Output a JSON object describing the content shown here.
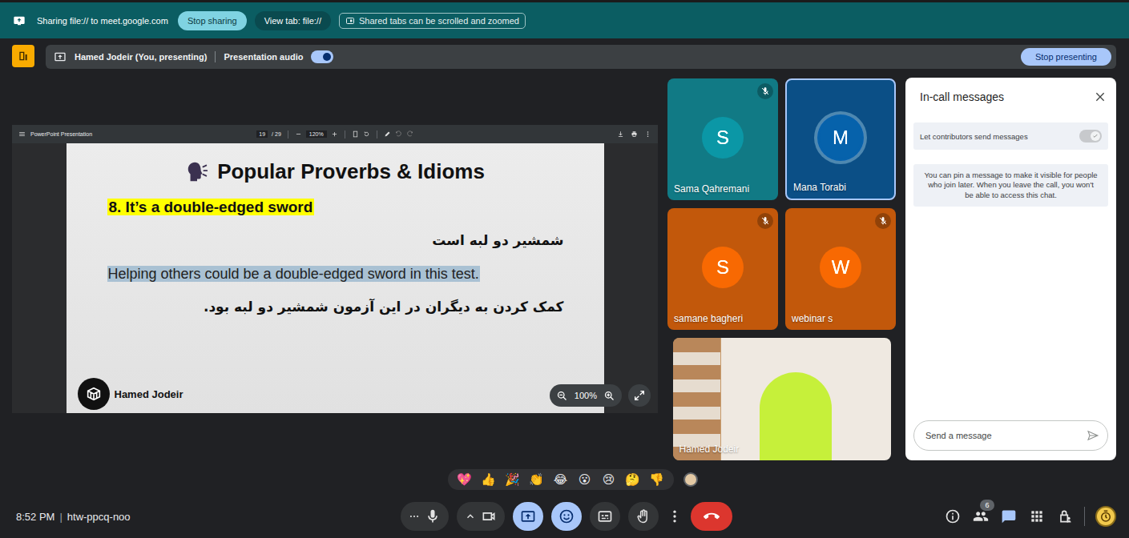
{
  "share_bar": {
    "status": "Sharing file:// to meet.google.com",
    "stop": "Stop sharing",
    "view_tab": "View tab: file://",
    "hint": "Shared tabs can be scrolled and zoomed"
  },
  "presenter_bar": {
    "presenter": "Hamed Jodeir (You, presenting)",
    "audio_label": "Presentation audio",
    "audio_on": true,
    "stop": "Stop presenting"
  },
  "viewer": {
    "title": "PowerPoint Presentation",
    "page": "19",
    "pages": "/ 29",
    "zoom": "120%",
    "fit_zoom": "100%"
  },
  "slide": {
    "title": "Popular Proverbs & Idioms",
    "idiom": "8. It’s a double-edged sword",
    "idiom_fa": "شمشیر دو لبه است",
    "example": "Helping others could be a double-edged sword in this test.",
    "example_fa": "کمک کردن به دیگران در این آزمون شمشیر دو لبه بود.",
    "author": "Hamed Jodeir"
  },
  "participants": [
    {
      "name": "Sama Qahremani",
      "initial": "S",
      "muted": true,
      "speaking": false,
      "color": "#117a85"
    },
    {
      "name": "Mana Torabi",
      "initial": "M",
      "muted": false,
      "speaking": true,
      "color": "#0b4f86"
    },
    {
      "name": "samane bagheri",
      "initial": "S",
      "muted": true,
      "speaking": false,
      "color": "#c2580b"
    },
    {
      "name": "webinar s",
      "initial": "W",
      "muted": true,
      "speaking": false,
      "color": "#c2580b"
    }
  ],
  "self_view": {
    "name": "Hamed Jodeir"
  },
  "chat": {
    "title": "In-call messages",
    "setting": {
      "label": "Let contributors send messages",
      "on": true
    },
    "info": "You can pin a message to make it visible for people who join later. When you leave the call, you won't be able to access this chat.",
    "placeholder": "Send a message"
  },
  "reactions": [
    "💖",
    "👍",
    "🎉",
    "👏",
    "😂",
    "😮",
    "😢",
    "🤔",
    "👎"
  ],
  "meeting": {
    "time": "8:52 PM",
    "separator": "|",
    "code": "htw-ppcq-noo"
  },
  "controls": [
    {
      "kind": "mic",
      "active": false
    },
    {
      "kind": "camera",
      "active": false
    },
    {
      "kind": "present",
      "active": true
    },
    {
      "kind": "reactions",
      "active": true
    },
    {
      "kind": "captions",
      "active": false
    },
    {
      "kind": "hand",
      "active": false
    },
    {
      "kind": "more",
      "active": false
    },
    {
      "kind": "leave",
      "active": false
    }
  ],
  "side_controls": [
    {
      "kind": "info",
      "active": false
    },
    {
      "kind": "people",
      "active": false,
      "badge": "6"
    },
    {
      "kind": "chat",
      "active": true
    },
    {
      "kind": "apps",
      "active": false
    },
    {
      "kind": "host",
      "active": false
    }
  ]
}
